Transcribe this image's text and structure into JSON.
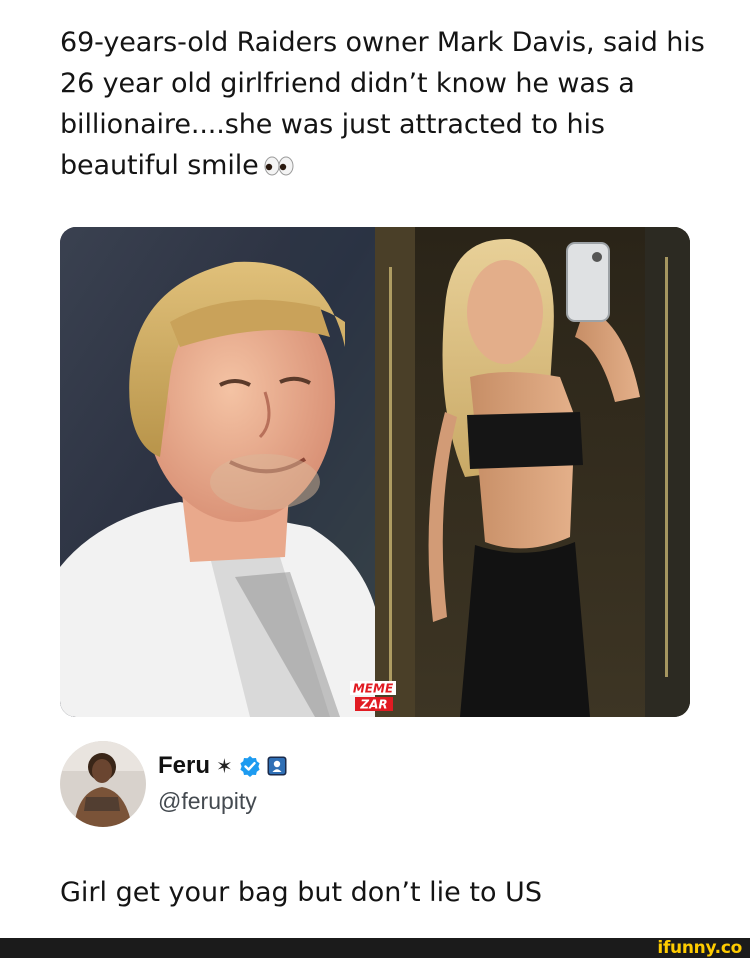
{
  "post": {
    "headline": "69-years-old Raiders owner Mark Davis, said his 26 year old girlfriend didn’t know he was a billionaire....she was just attracted to his beautiful smile",
    "headline_emoji": "eyes-icon",
    "media": {
      "left_photo": "man-in-white-jacket-smiling",
      "right_photo": "woman-taking-mirror-selfie",
      "watermark_line1": "MEME",
      "watermark_line2": "ZAR"
    }
  },
  "author": {
    "display_name": "Feru",
    "name_symbol": "✶",
    "verified": "verified-badge-icon",
    "affiliate": "affiliate-badge-icon",
    "handle": "@ferupity"
  },
  "reply": {
    "text": "Girl get your bag but don’t lie to US"
  },
  "footer": {
    "brand": "ifunny.co",
    "brand_color": "#ffcc00"
  },
  "colors": {
    "verified_blue": "#1d9bf0",
    "text": "#141414",
    "muted": "#444a50"
  }
}
